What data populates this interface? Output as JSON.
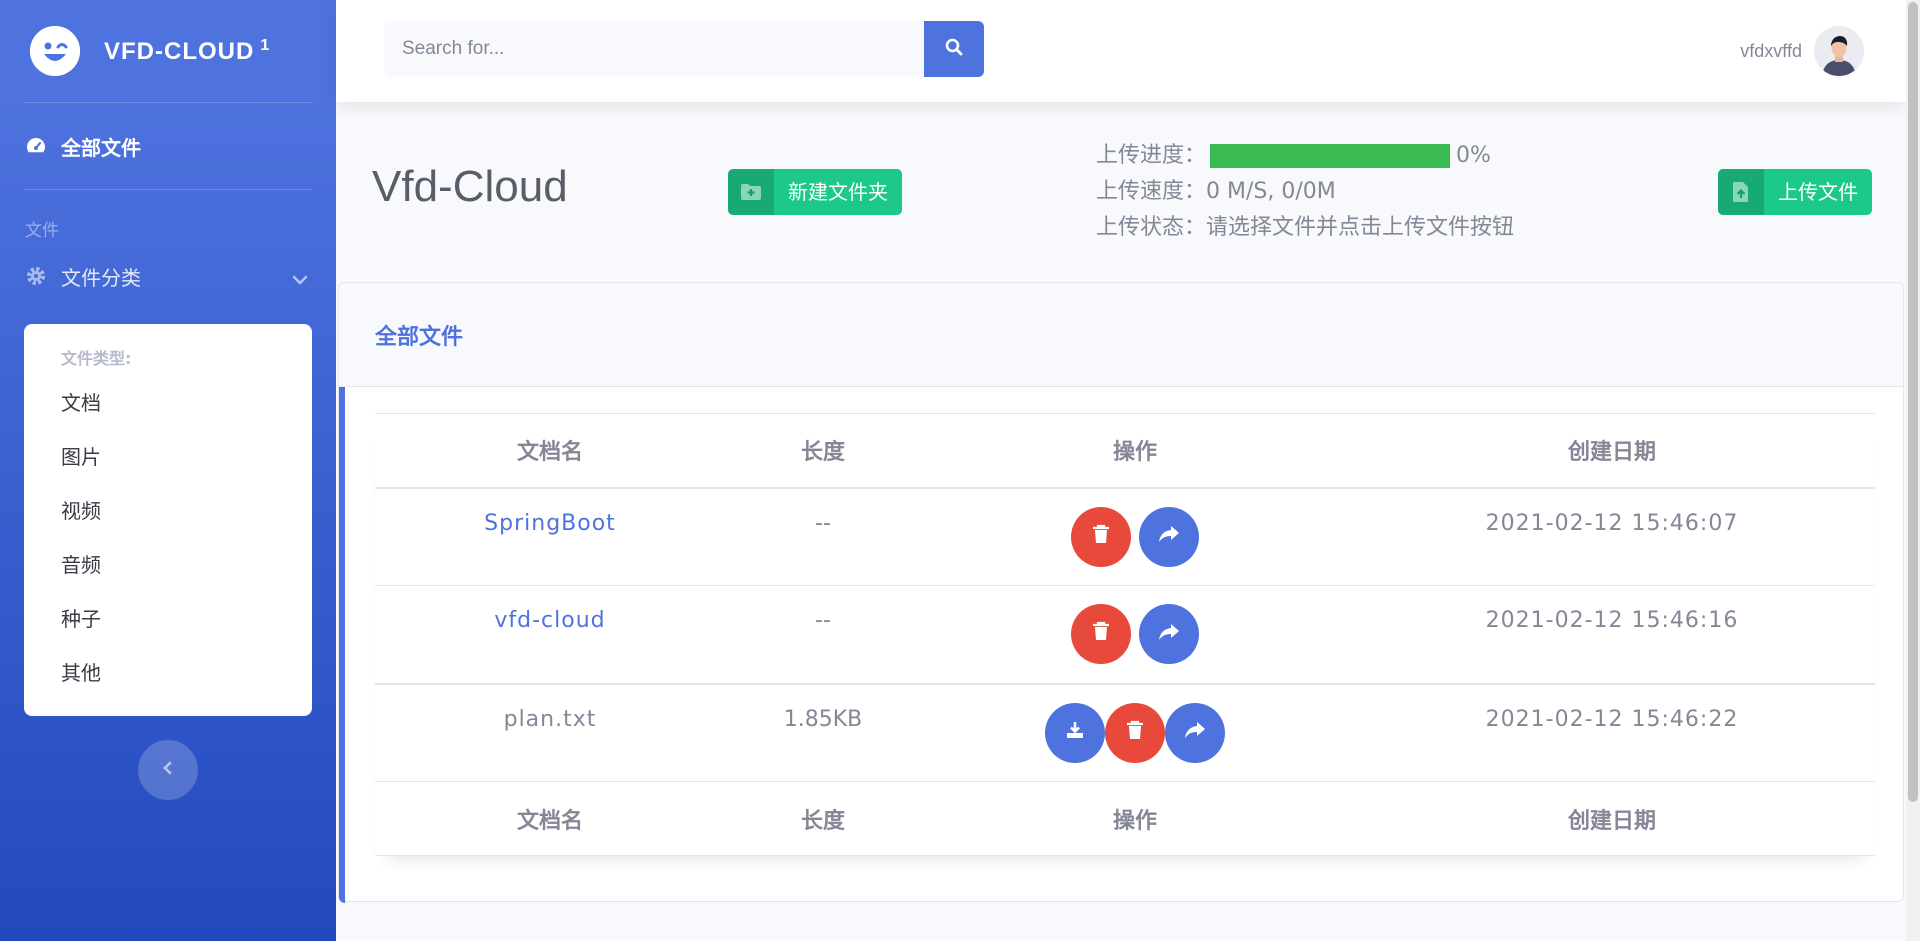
{
  "brand": {
    "name": "VFD-CLOUD",
    "superscript": "1"
  },
  "sidebar": {
    "active_item": "全部文件",
    "heading": "文件",
    "category_toggle": "文件分类",
    "collapse": {
      "header": "文件类型:",
      "items": [
        "文档",
        "图片",
        "视频",
        "音频",
        "种子",
        "其他"
      ]
    }
  },
  "topbar": {
    "search_placeholder": "Search for...",
    "username": "vfdxvffd"
  },
  "page": {
    "title": "Vfd-Cloud",
    "new_folder_label": "新建文件夹",
    "upload_label": "上传文件",
    "upload_progress_label": "上传进度：",
    "upload_progress_value": "0%",
    "upload_progress_fraction": 1.0,
    "upload_speed_label": "上传速度：",
    "upload_speed_value": "0 M/S, 0/0M",
    "upload_status_label": "上传状态：",
    "upload_status_value": "请选择文件并点击上传文件按钮"
  },
  "card": {
    "title": "全部文件",
    "columns": [
      "文档名",
      "长度",
      "操作",
      "创建日期"
    ],
    "rows": [
      {
        "name": "SpringBoot",
        "size": "--",
        "date": "2021-02-12 15:46:07",
        "type": "folder"
      },
      {
        "name": "vfd-cloud",
        "size": "--",
        "date": "2021-02-12 15:46:16",
        "type": "folder"
      },
      {
        "name": "plan.txt",
        "size": "1.85KB",
        "date": "2021-02-12 15:46:22",
        "type": "file"
      }
    ]
  },
  "colors": {
    "primary": "#4e73df",
    "success": "#1cc88a",
    "danger": "#e74a3b",
    "progress": "#3cba54"
  }
}
